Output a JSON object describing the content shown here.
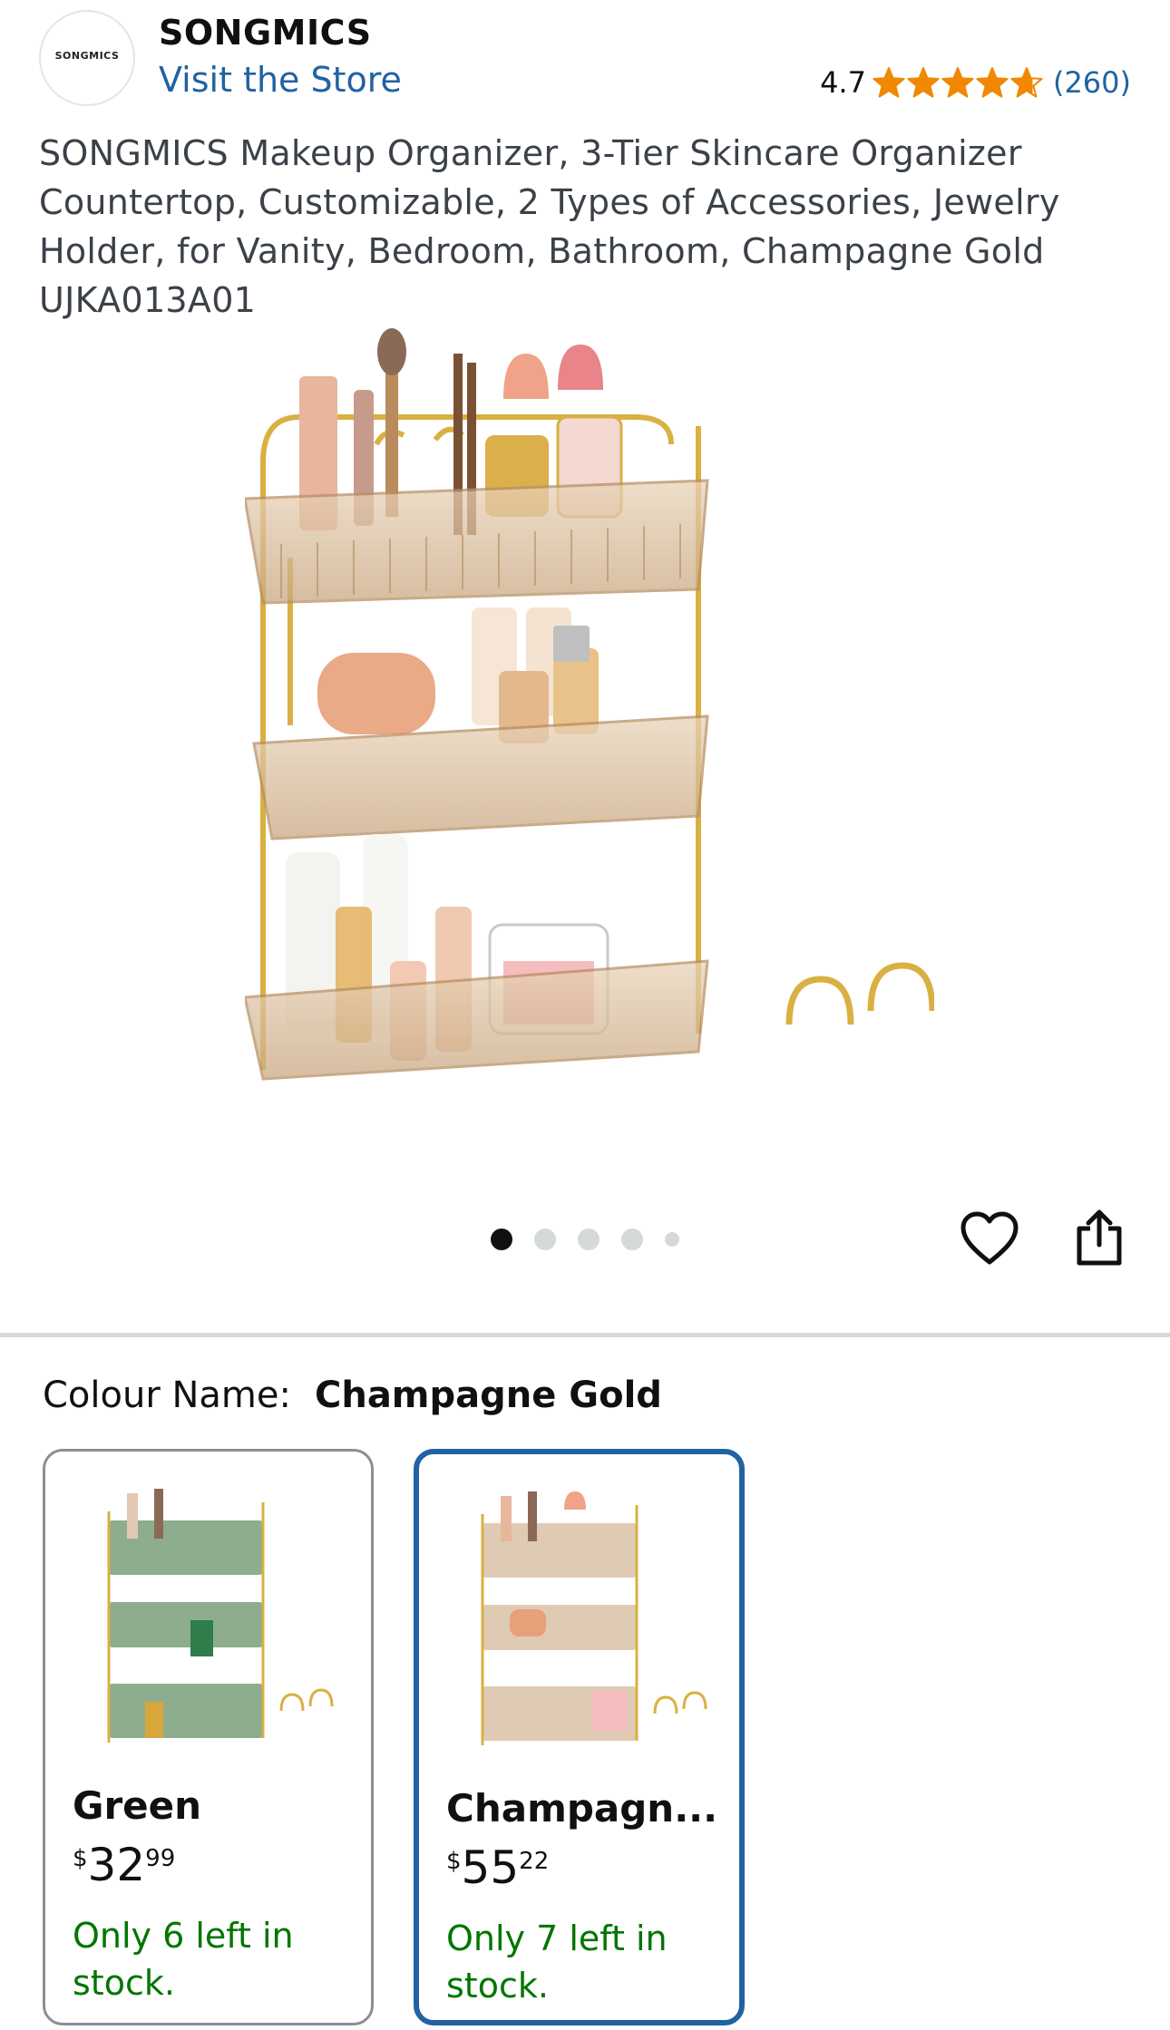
{
  "header": {
    "logo_text": "SONGMICS",
    "brand": "SONGMICS",
    "visit_store": "Visit the Store",
    "rating_value": "4.7",
    "rating_count": "(260)",
    "stars": 4.7
  },
  "product": {
    "title": "SONGMICS Makeup Organizer, 3-Tier Skincare Organizer Countertop, Customizable, 2 Types of Accessories, Jewelry Holder, for Vanity, Bedroom, Bathroom, Champagne Gold UJKA013A01"
  },
  "gallery": {
    "total_images": 5,
    "active_index": 0,
    "favorite_icon": "heart-icon",
    "share_icon": "share-icon"
  },
  "variations": {
    "label": "Colour Name:",
    "selected": "Champagne Gold",
    "options": [
      {
        "name": "Green",
        "price_currency": "$",
        "price_whole": "32",
        "price_fraction": "99",
        "stock": "Only 6 left in stock.",
        "tint": "#5c8a5e"
      },
      {
        "name": "Champagn...",
        "price_currency": "$",
        "price_whole": "55",
        "price_fraction": "22",
        "stock": "Only 7 left in stock.",
        "tint": "#c9a882"
      }
    ]
  },
  "colors": {
    "link": "#2162a1",
    "star": "#f08804",
    "stock": "#007600",
    "selected_border": "#2162a1"
  }
}
